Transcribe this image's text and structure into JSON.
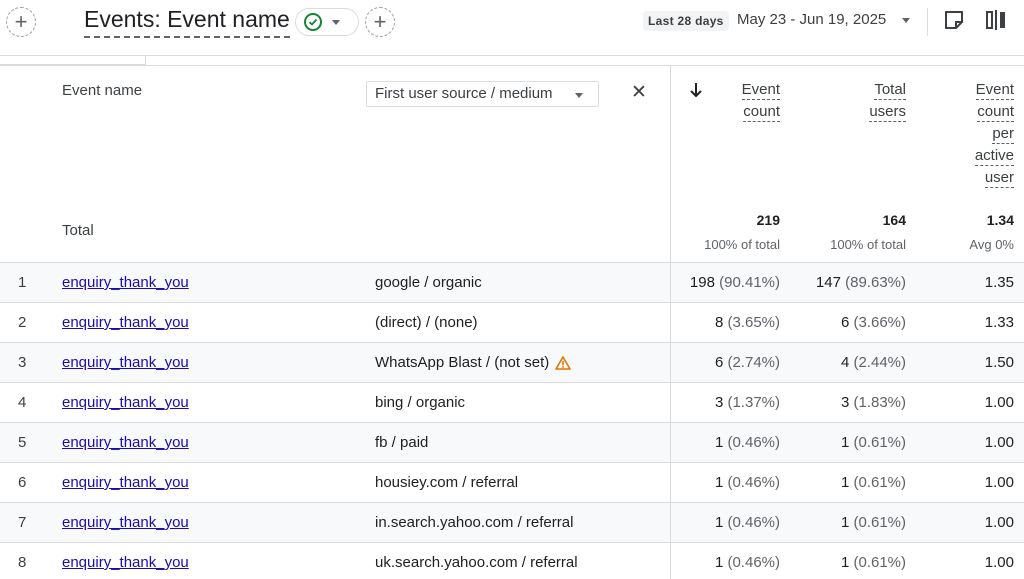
{
  "header": {
    "title": "Events: Event name",
    "range_label": "Last 28 days",
    "date_range": "May 23 - Jun 19, 2025"
  },
  "table": {
    "dimension_header": "Event name",
    "secondary_dimension": "First user source / medium",
    "metrics": [
      {
        "words": [
          "Event",
          "count"
        ]
      },
      {
        "words": [
          "Total",
          "users"
        ]
      },
      {
        "words": [
          "Event",
          "count",
          "per",
          "active",
          "user"
        ]
      }
    ],
    "total": {
      "label": "Total",
      "event_count": "219",
      "event_count_sub": "100% of total",
      "total_users": "164",
      "total_users_sub": "100% of total",
      "per_user": "1.34",
      "per_user_sub": "Avg 0%"
    },
    "rows": [
      {
        "n": "1",
        "event": "enquiry_thank_you",
        "source": "google / organic",
        "ec": "198",
        "ec_pct": "(90.41%)",
        "tu": "147",
        "tu_pct": "(89.63%)",
        "pu": "1.35",
        "warn": false
      },
      {
        "n": "2",
        "event": "enquiry_thank_you",
        "source": "(direct) / (none)",
        "ec": "8",
        "ec_pct": "(3.65%)",
        "tu": "6",
        "tu_pct": "(3.66%)",
        "pu": "1.33",
        "warn": false
      },
      {
        "n": "3",
        "event": "enquiry_thank_you",
        "source": "WhatsApp Blast / (not set)",
        "ec": "6",
        "ec_pct": "(2.74%)",
        "tu": "4",
        "tu_pct": "(2.44%)",
        "pu": "1.50",
        "warn": true
      },
      {
        "n": "4",
        "event": "enquiry_thank_you",
        "source": "bing / organic",
        "ec": "3",
        "ec_pct": "(1.37%)",
        "tu": "3",
        "tu_pct": "(1.83%)",
        "pu": "1.00",
        "warn": false
      },
      {
        "n": "5",
        "event": "enquiry_thank_you",
        "source": "fb / paid",
        "ec": "1",
        "ec_pct": "(0.46%)",
        "tu": "1",
        "tu_pct": "(0.61%)",
        "pu": "1.00",
        "warn": false
      },
      {
        "n": "6",
        "event": "enquiry_thank_you",
        "source": "housiey.com / referral",
        "ec": "1",
        "ec_pct": "(0.46%)",
        "tu": "1",
        "tu_pct": "(0.61%)",
        "pu": "1.00",
        "warn": false
      },
      {
        "n": "7",
        "event": "enquiry_thank_you",
        "source": "in.search.yahoo.com / referral",
        "ec": "1",
        "ec_pct": "(0.46%)",
        "tu": "1",
        "tu_pct": "(0.61%)",
        "pu": "1.00",
        "warn": false
      },
      {
        "n": "8",
        "event": "enquiry_thank_you",
        "source": "uk.search.yahoo.com / referral",
        "ec": "1",
        "ec_pct": "(0.46%)",
        "tu": "1",
        "tu_pct": "(0.61%)",
        "pu": "1.00",
        "warn": false
      }
    ]
  },
  "colors": {
    "link": "#1a0dab",
    "check": "#188038",
    "warning": "#e37400"
  }
}
